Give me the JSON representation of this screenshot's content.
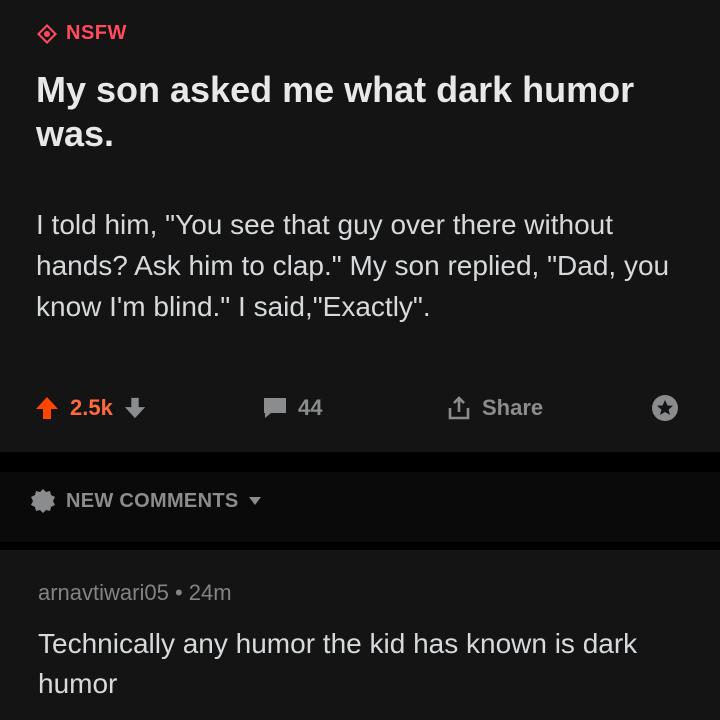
{
  "post": {
    "nsfw_label": "NSFW",
    "title": "My son asked me what dark humor was.",
    "body": "I told him, \"You see that guy over there without hands? Ask him to clap.\" My son replied, \"Dad, you know I'm blind.\" I said,\"Exactly\".",
    "score": "2.5k",
    "comment_count": "44",
    "share_label": "Share",
    "icons": {
      "nsfw": "nsfw-diamond-icon",
      "upvote": "upvote-arrow-icon",
      "downvote": "downvote-arrow-icon",
      "comments": "comment-bubble-icon",
      "share": "share-icon",
      "award": "award-icon"
    }
  },
  "sort": {
    "label": "NEW COMMENTS",
    "icons": {
      "sort": "sort-badge-icon",
      "dropdown": "caret-down-icon"
    }
  },
  "comment": {
    "author": "arnavtiwari05",
    "separator": "•",
    "age": "24m",
    "text": "Technically any humor the kid has known is dark humor"
  },
  "colors": {
    "background": "#000000",
    "card": "#141414",
    "nsfw": "#ff4b5c",
    "upvote": "#ff6a3d",
    "muted": "#8a8c8e",
    "text": "#d7dadc"
  }
}
